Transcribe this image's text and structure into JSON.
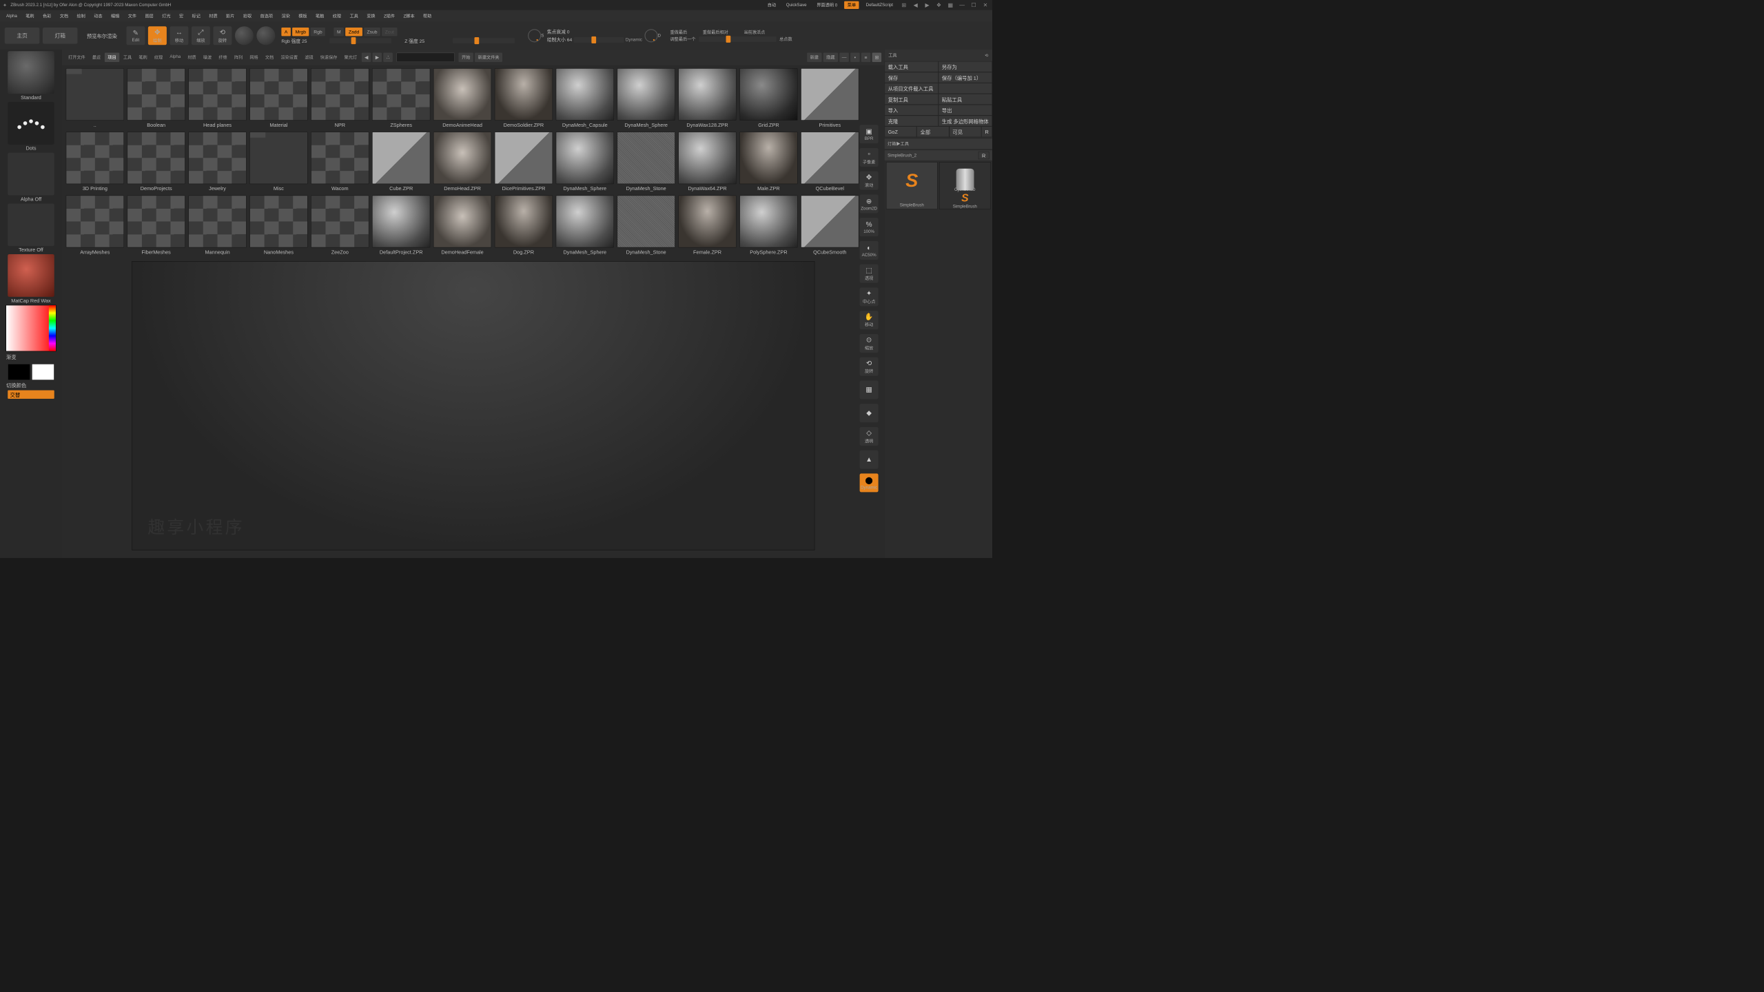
{
  "titlebar": {
    "title": "ZBrush 2023.2.1 [n1z] by Ofer Alon @ Copyright 1997-2023 Maxon Computer GmbH",
    "auto": "自动",
    "quicksave": "QuickSave",
    "opacity": "界面透明 0",
    "menu": "菜单",
    "defaultscript": "DefaultZScript"
  },
  "menubar": [
    "Alpha",
    "笔刷",
    "色彩",
    "文档",
    "绘制",
    "动态",
    "编辑",
    "文件",
    "图层",
    "灯光",
    "宏",
    "标记",
    "材质",
    "影片",
    "拾取",
    "首选项",
    "渲染",
    "模板",
    "笔触",
    "纹理",
    "工具",
    "变换",
    "Z插件",
    "Z脚本",
    "帮助"
  ],
  "toolbar": {
    "tab1": "主页",
    "tab2": "灯箱",
    "preview": "预览布尔渲染",
    "edit": "Edit",
    "draw": "绘制",
    "move": "移动",
    "scale": "缩放",
    "rotate": "旋转",
    "rgb_a": "A",
    "mrgb": "Mrgb",
    "rgb": "Rgb",
    "m": "M",
    "zadd": "Zadd",
    "zsub": "Zsub",
    "zcut": "Zcut",
    "rgb_intensity": "Rgb 强度 25",
    "z_intensity": "Z 强度 25",
    "focal": "焦点衰减 0",
    "drawsize": "绘制大小 64",
    "dynamic": "Dynamic",
    "s_label": "S",
    "d_label": "D",
    "undo": "重做最后",
    "redo": "重做最后相对",
    "active": "当前激活点",
    "adjust": "调整最后一个",
    "total": "总点数"
  },
  "leftrail": {
    "standard": "Standard",
    "dots": "Dots",
    "alphaoff": "Alpha Off",
    "textureoff": "Texture Off",
    "matcap": "MatCap Red Wax",
    "gradient": "渐变",
    "swap": "切换颜色",
    "alt": "交替"
  },
  "browser": {
    "tabs": [
      "打开文件",
      "最近",
      "项目",
      "工具",
      "笔刷",
      "纹理",
      "Alpha",
      "材质",
      "噪波",
      "纤维",
      "阵列",
      "网格",
      "文档",
      "渲染设置",
      "滤镜",
      "快速保存",
      "聚光灯"
    ],
    "selected": 2,
    "start": "开始",
    "newfolder": "新建文件夹",
    "new": "新建",
    "hide": "隐藏"
  },
  "grid": [
    {
      "l": "..",
      "c": "folder"
    },
    {
      "l": "Boolean",
      "c": "mosaic"
    },
    {
      "l": "Head planes",
      "c": "mosaic"
    },
    {
      "l": "Material",
      "c": "mosaic"
    },
    {
      "l": "NPR",
      "c": "mosaic"
    },
    {
      "l": "ZSpheres",
      "c": "mosaic"
    },
    {
      "l": "DemoAnimeHead",
      "c": "head"
    },
    {
      "l": "DemoSoldier.ZPR",
      "c": "body"
    },
    {
      "l": "DynaMesh_Capsule",
      "c": "sphere"
    },
    {
      "l": "DynaMesh_Sphere",
      "c": "sphere"
    },
    {
      "l": "DynaWax128.ZPR",
      "c": "sphere"
    },
    {
      "l": "Grid.ZPR",
      "c": "dark-sphere"
    },
    {
      "l": "Primitives",
      "c": "cube"
    },
    {
      "l": "3D Printing",
      "c": "mosaic"
    },
    {
      "l": "DemoProjects",
      "c": "mosaic"
    },
    {
      "l": "Jewelry",
      "c": "mosaic"
    },
    {
      "l": "Misc",
      "c": "folder"
    },
    {
      "l": "Wacom",
      "c": "mosaic"
    },
    {
      "l": "Cube.ZPR",
      "c": "cube"
    },
    {
      "l": "DemoHead.ZPR",
      "c": "head"
    },
    {
      "l": "DicePrimitives.ZPR",
      "c": "cube"
    },
    {
      "l": "DynaMesh_Sphere",
      "c": "sphere"
    },
    {
      "l": "DynaMesh_Stone",
      "c": "noise"
    },
    {
      "l": "DynaWax64.ZPR",
      "c": "sphere"
    },
    {
      "l": "Male.ZPR",
      "c": "body"
    },
    {
      "l": "QCubeBevel",
      "c": "cube"
    },
    {
      "l": "ArrayMeshes",
      "c": "mosaic"
    },
    {
      "l": "FiberMeshes",
      "c": "mosaic"
    },
    {
      "l": "Mannequin",
      "c": "mosaic"
    },
    {
      "l": "NanoMeshes",
      "c": "mosaic"
    },
    {
      "l": "ZeeZoo",
      "c": "mosaic"
    },
    {
      "l": "DefaultProject.ZPR",
      "c": "sphere"
    },
    {
      "l": "DemoHeadFemale",
      "c": "head"
    },
    {
      "l": "Dog.ZPR",
      "c": "body"
    },
    {
      "l": "DynaMesh_Sphere",
      "c": "sphere"
    },
    {
      "l": "DynaMesh_Stone",
      "c": "noise"
    },
    {
      "l": "Female.ZPR",
      "c": "body"
    },
    {
      "l": "PolySphere.ZPR",
      "c": "sphere"
    },
    {
      "l": "QCubeSmooth",
      "c": "cube"
    }
  ],
  "innerrail": [
    "BPR",
    "子像素",
    "滚动",
    "Zoom2D",
    "100%",
    "AC50%",
    "透视",
    "中心点",
    "移动",
    "缩放",
    "旋转",
    "",
    "",
    "透明",
    "",
    "Dynamic"
  ],
  "innerrail_orange": [
    15
  ],
  "watermark": "趣享小程序",
  "rightpanel": {
    "title": "工具",
    "rows": [
      [
        "载入工具",
        "另存为"
      ],
      [
        "保存",
        "保存（编号加 1）"
      ],
      [
        "从项目文件载入工具",
        ""
      ],
      [
        "复制工具",
        "粘贴工具"
      ],
      [
        "导入",
        "导出"
      ],
      [
        "克隆",
        "生成 多边形网格物体"
      ],
      [
        "GoZ",
        "全部",
        "可见",
        "R"
      ]
    ],
    "lightbox": "灯箱▶工具",
    "current": "SimpleBrush_2",
    "r": "R",
    "tool1": "SimpleBrush",
    "tool2_top": "Cylinder3D",
    "tool2": "SimpleBrush"
  }
}
